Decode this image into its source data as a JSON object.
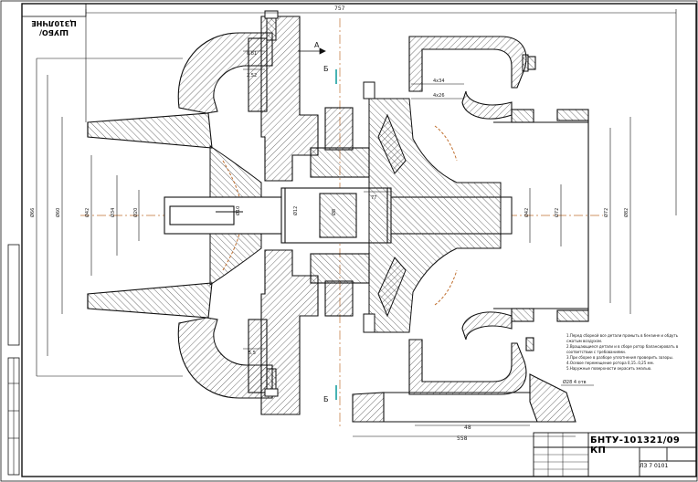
{
  "drawing": {
    "code": "БНТУ-101321/09 КП",
    "side_code": "ШУБО/ЦЗ10ЛЧНЕ",
    "sheet": "ЛЗ 7 0101",
    "view_a": "А",
    "section_b_top": "Б",
    "section_b_bottom": "Б"
  },
  "dimensions": {
    "overall_top": "757",
    "bottom_short": "48",
    "bottom_long": "558",
    "right_1": "Ø42",
    "right_2": "Ø72",
    "right_3": "Ø82",
    "left_1": "Ø66",
    "left_2": "Ø60",
    "left_3": "Ø42",
    "left_4": "Ø34",
    "left_5": "Ø20",
    "shaft_1": "Ø10",
    "shaft_2": "Ø12",
    "shaft_3": "Ø8",
    "small_1": "77",
    "small_2": "0,81",
    "small_3": "2,52",
    "small_4": "5,5",
    "tr_1": "4x34",
    "tr_2": "4x26",
    "foot": "Ø28 4 отв"
  },
  "notes": [
    "1.Перед сборкой все детали промыть в бензине и обдуть сжатым воздухом.",
    "2.Вращающиеся детали и в сборе ротор балансировать в соответствии с требованиями.",
    "3.При сборке в разборе уплотнения проверить зазоры.",
    "4.Осевое перемещение ротора 0,15..0,25 мм.",
    "5.Наружные поверхности окрасить эмалью."
  ],
  "colors": {
    "line": "#111111",
    "axis": "#c07030",
    "hatch": "#333333",
    "accent": "#19a0a0"
  }
}
